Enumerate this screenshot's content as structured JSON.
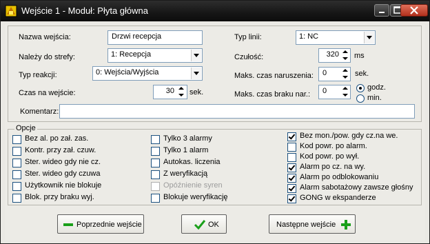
{
  "window": {
    "title": "Wejście 1 - Moduł: Płyta główna"
  },
  "form": {
    "name_label": "Nazwa wejścia:",
    "name_value": "Drzwi recepcja",
    "zone_label": "Należy do strefy:",
    "zone_value": "1: Recepcja",
    "reaction_label": "Typ reakcji:",
    "reaction_value": "0: Wejścia/Wyjścia",
    "entry_time_label": "Czas na wejście:",
    "entry_time_value": "30",
    "entry_time_unit": "sek.",
    "line_type_label": "Typ linii:",
    "line_type_value": "1: NC",
    "sensitivity_label": "Czułość:",
    "sensitivity_value": "320",
    "sensitivity_unit": "ms",
    "max_violation_label": "Maks. czas naruszenia:",
    "max_violation_value": "0",
    "max_violation_unit": "sek.",
    "max_no_violation_label": "Maks. czas braku nar.:",
    "max_no_violation_value": "0",
    "unit_hours_label": "godz.",
    "unit_minutes_label": "min.",
    "selected_unit": "godz.",
    "comment_label": "Komentarz:",
    "comment_value": ""
  },
  "options": {
    "title": "Opcje",
    "col1": [
      {
        "label": "Bez al. po zał. zas.",
        "checked": false
      },
      {
        "label": "Kontr. przy zał. czuw.",
        "checked": false
      },
      {
        "label": "Ster. wideo gdy nie cz.",
        "checked": false
      },
      {
        "label": "Ster. wideo gdy czuwa",
        "checked": false
      },
      {
        "label": "Użytkownik nie blokuje",
        "checked": false
      },
      {
        "label": "Blok. przy braku wyj.",
        "checked": false
      }
    ],
    "col2": [
      {
        "label": "Tylko 3 alarmy",
        "checked": false
      },
      {
        "label": "Tylko 1 alarm",
        "checked": false
      },
      {
        "label": "Autokas. liczenia",
        "checked": false
      },
      {
        "label": "Z weryfikacją",
        "checked": false
      },
      {
        "label": "Opóźnienie syren",
        "checked": false
      },
      {
        "label": "Blokuje weryfikację",
        "checked": false
      }
    ],
    "col3": [
      {
        "label": "Bez mon./pow. gdy cz.na we.",
        "checked": true
      },
      {
        "label": "Kod powr. po alarm.",
        "checked": false
      },
      {
        "label": "Kod powr. po wył.",
        "checked": false
      },
      {
        "label": "Alarm po cz. na wy.",
        "checked": true
      },
      {
        "label": "Alarm po odblokowaniu",
        "checked": true
      },
      {
        "label": "Alarm sabotażowy zawsze głośny",
        "checked": true
      },
      {
        "label": "GONG w ekspanderze",
        "checked": true
      }
    ]
  },
  "buttons": {
    "prev_label": "Poprzednie wejście",
    "ok_label": "OK",
    "next_label": "Następne wejście"
  },
  "colors": {
    "accent_green": "#1aa01a",
    "titlebar_bg": "#161616",
    "dialog_bg": "#ecebe6"
  }
}
